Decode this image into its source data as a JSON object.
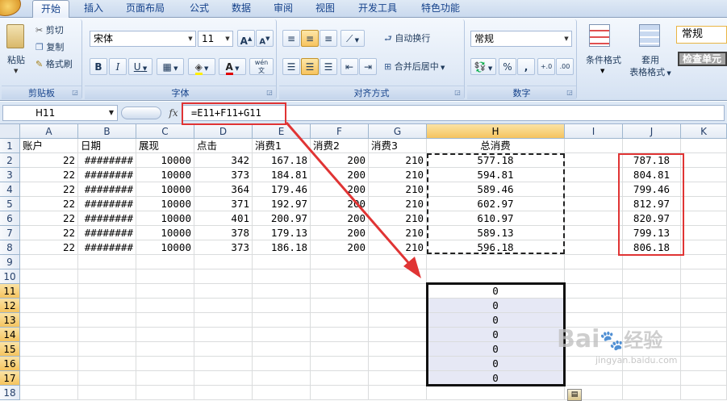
{
  "ribbon": {
    "tabs": [
      "开始",
      "插入",
      "页面布局",
      "公式",
      "数据",
      "审阅",
      "视图",
      "开发工具",
      "特色功能"
    ],
    "active_tab": "开始",
    "clipboard": {
      "paste": "粘贴",
      "cut": "剪切",
      "copy": "复制",
      "format_painter": "格式刷",
      "label": "剪贴板"
    },
    "font": {
      "name": "宋体",
      "size": "11",
      "grow": "A",
      "shrink": "A",
      "bold": "B",
      "italic": "I",
      "underline": "U",
      "label": "字体",
      "phonetic": "wén"
    },
    "alignment": {
      "wrap": "自动换行",
      "merge": "合并后居中",
      "label": "对齐方式"
    },
    "number": {
      "format": "常规",
      "percent": "%",
      "comma": ",",
      "label": "数字"
    },
    "styles": {
      "conditional": "条件格式",
      "table_line1": "套用",
      "table_line2": "表格格式",
      "style_normal": "常规",
      "style_check": "检查单元"
    }
  },
  "formula_bar": {
    "name_box": "H11",
    "fx": "fx",
    "formula": "=E11+F11+G11"
  },
  "colors": {
    "annotation_red": "#e03434",
    "selection_fill": "#e6e8f5",
    "active_header": "#f5c45f"
  },
  "sheet": {
    "columns": [
      "A",
      "B",
      "C",
      "D",
      "E",
      "F",
      "G",
      "H",
      "I",
      "J",
      "K"
    ],
    "rows": [
      "1",
      "2",
      "3",
      "4",
      "5",
      "6",
      "7",
      "8",
      "9",
      "10",
      "11",
      "12",
      "13",
      "14",
      "15",
      "16",
      "17",
      "18"
    ],
    "headers": {
      "A": "账户",
      "B": "日期",
      "C": "展现",
      "D": "点击",
      "E": "消费1",
      "F": "消费2",
      "G": "消费3",
      "H": "总消费"
    },
    "data": [
      [
        "22",
        "########",
        "10000",
        "342",
        "167.18",
        "200",
        "210",
        "577.18",
        "",
        "787.18"
      ],
      [
        "22",
        "########",
        "10000",
        "373",
        "184.81",
        "200",
        "210",
        "594.81",
        "",
        "804.81"
      ],
      [
        "22",
        "########",
        "10000",
        "364",
        "179.46",
        "200",
        "210",
        "589.46",
        "",
        "799.46"
      ],
      [
        "22",
        "########",
        "10000",
        "371",
        "192.97",
        "200",
        "210",
        "602.97",
        "",
        "812.97"
      ],
      [
        "22",
        "########",
        "10000",
        "401",
        "200.97",
        "200",
        "210",
        "610.97",
        "",
        "820.97"
      ],
      [
        "22",
        "########",
        "10000",
        "378",
        "179.13",
        "200",
        "210",
        "589.13",
        "",
        "799.13"
      ],
      [
        "22",
        "########",
        "10000",
        "373",
        "186.18",
        "200",
        "210",
        "596.18",
        "",
        "806.18"
      ]
    ],
    "result_cells": [
      "0",
      "0",
      "0",
      "0",
      "0",
      "0",
      "0"
    ]
  },
  "watermark": {
    "brand": "Bai",
    "brand_cn": "经验",
    "url": "jingyan.baidu.com"
  }
}
